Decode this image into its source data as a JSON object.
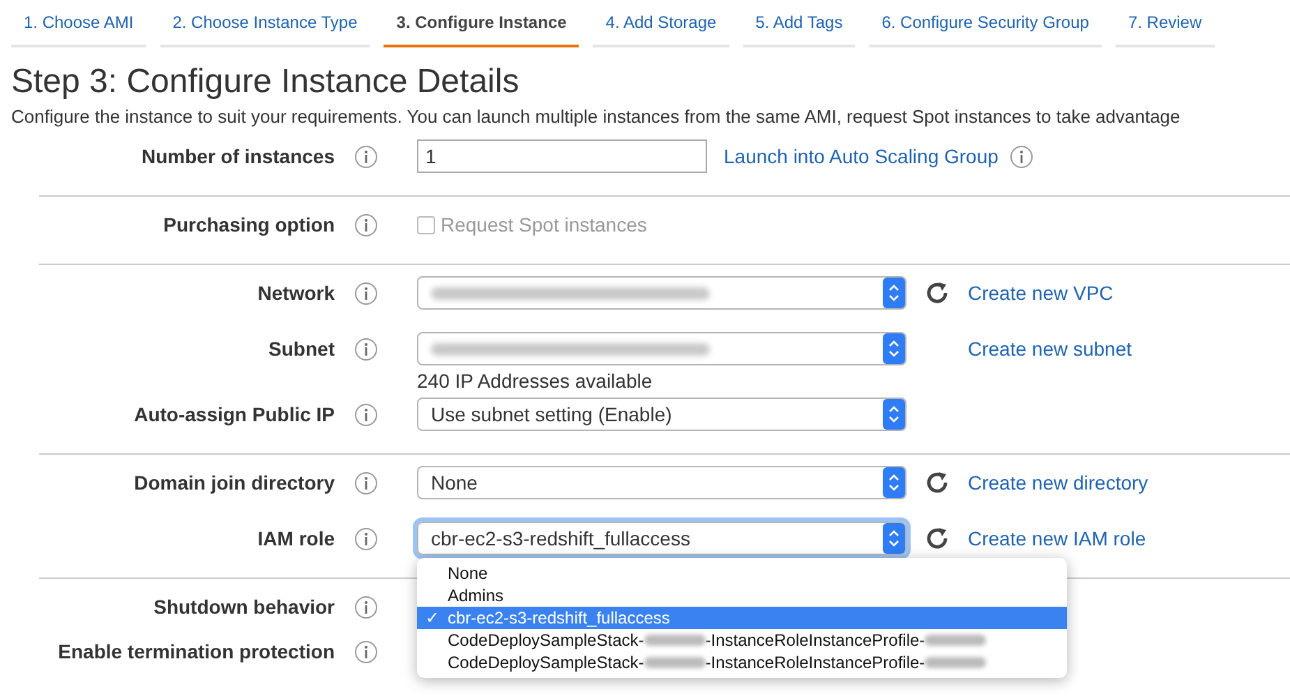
{
  "tabs": [
    {
      "label": "1. Choose AMI",
      "selected": false
    },
    {
      "label": "2. Choose Instance Type",
      "selected": false
    },
    {
      "label": "3. Configure Instance",
      "selected": true
    },
    {
      "label": "4. Add Storage",
      "selected": false
    },
    {
      "label": "5. Add Tags",
      "selected": false
    },
    {
      "label": "6. Configure Security Group",
      "selected": false
    },
    {
      "label": "7. Review",
      "selected": false
    }
  ],
  "heading": "Step 3: Configure Instance Details",
  "description": "Configure the instance to suit your requirements. You can launch multiple instances from the same AMI, request Spot instances to take advantage",
  "sections": [
    {
      "rows": [
        {
          "label": "Number of instances",
          "kind": "input",
          "value": "1",
          "link": "Launch into Auto Scaling Group",
          "link_info": true
        }
      ]
    },
    {
      "rows": [
        {
          "label": "Purchasing option",
          "kind": "checkbox",
          "value": "Request Spot instances",
          "checked": false,
          "disabled": true
        }
      ]
    },
    {
      "rows": [
        {
          "label": "Network",
          "kind": "select",
          "redacted": true,
          "refresh": true,
          "link": "Create new VPC"
        },
        {
          "label": "Subnet",
          "kind": "select",
          "redacted": true,
          "refresh": false,
          "link": "Create new subnet",
          "note": "240 IP Addresses available"
        },
        {
          "label": "Auto-assign Public IP",
          "kind": "select",
          "value": "Use subnet setting (Enable)"
        }
      ]
    },
    {
      "rows": [
        {
          "label": "Domain join directory",
          "kind": "select",
          "value": "None",
          "refresh": true,
          "link": "Create new directory"
        },
        {
          "label": "IAM role",
          "kind": "select",
          "value": "cbr-ec2-s3-redshift_fullaccess",
          "refresh": true,
          "link": "Create new IAM role",
          "focused": true,
          "dropdown": {
            "check": "✓",
            "options": [
              {
                "selected": false,
                "segments": [
                  {
                    "kind": "text",
                    "text": "None"
                  }
                ]
              },
              {
                "selected": false,
                "segments": [
                  {
                    "kind": "text",
                    "text": "Admins"
                  }
                ]
              },
              {
                "selected": true,
                "segments": [
                  {
                    "kind": "text",
                    "text": "cbr-ec2-s3-redshift_fullaccess"
                  }
                ]
              },
              {
                "selected": false,
                "segments": [
                  {
                    "kind": "text",
                    "text": "CodeDeploySampleStack-"
                  },
                  {
                    "kind": "redacted"
                  },
                  {
                    "kind": "text",
                    "text": "-InstanceRoleInstanceProfile-"
                  },
                  {
                    "kind": "redacted"
                  }
                ]
              },
              {
                "selected": false,
                "segments": [
                  {
                    "kind": "text",
                    "text": "CodeDeploySampleStack-"
                  },
                  {
                    "kind": "redacted"
                  },
                  {
                    "kind": "text",
                    "text": "-InstanceRoleInstanceProfile-"
                  },
                  {
                    "kind": "redacted"
                  }
                ]
              }
            ]
          }
        }
      ]
    },
    {
      "rows": [
        {
          "label": "Shutdown behavior",
          "kind": "blank"
        },
        {
          "label": "Enable termination protection",
          "kind": "blank"
        }
      ]
    }
  ]
}
